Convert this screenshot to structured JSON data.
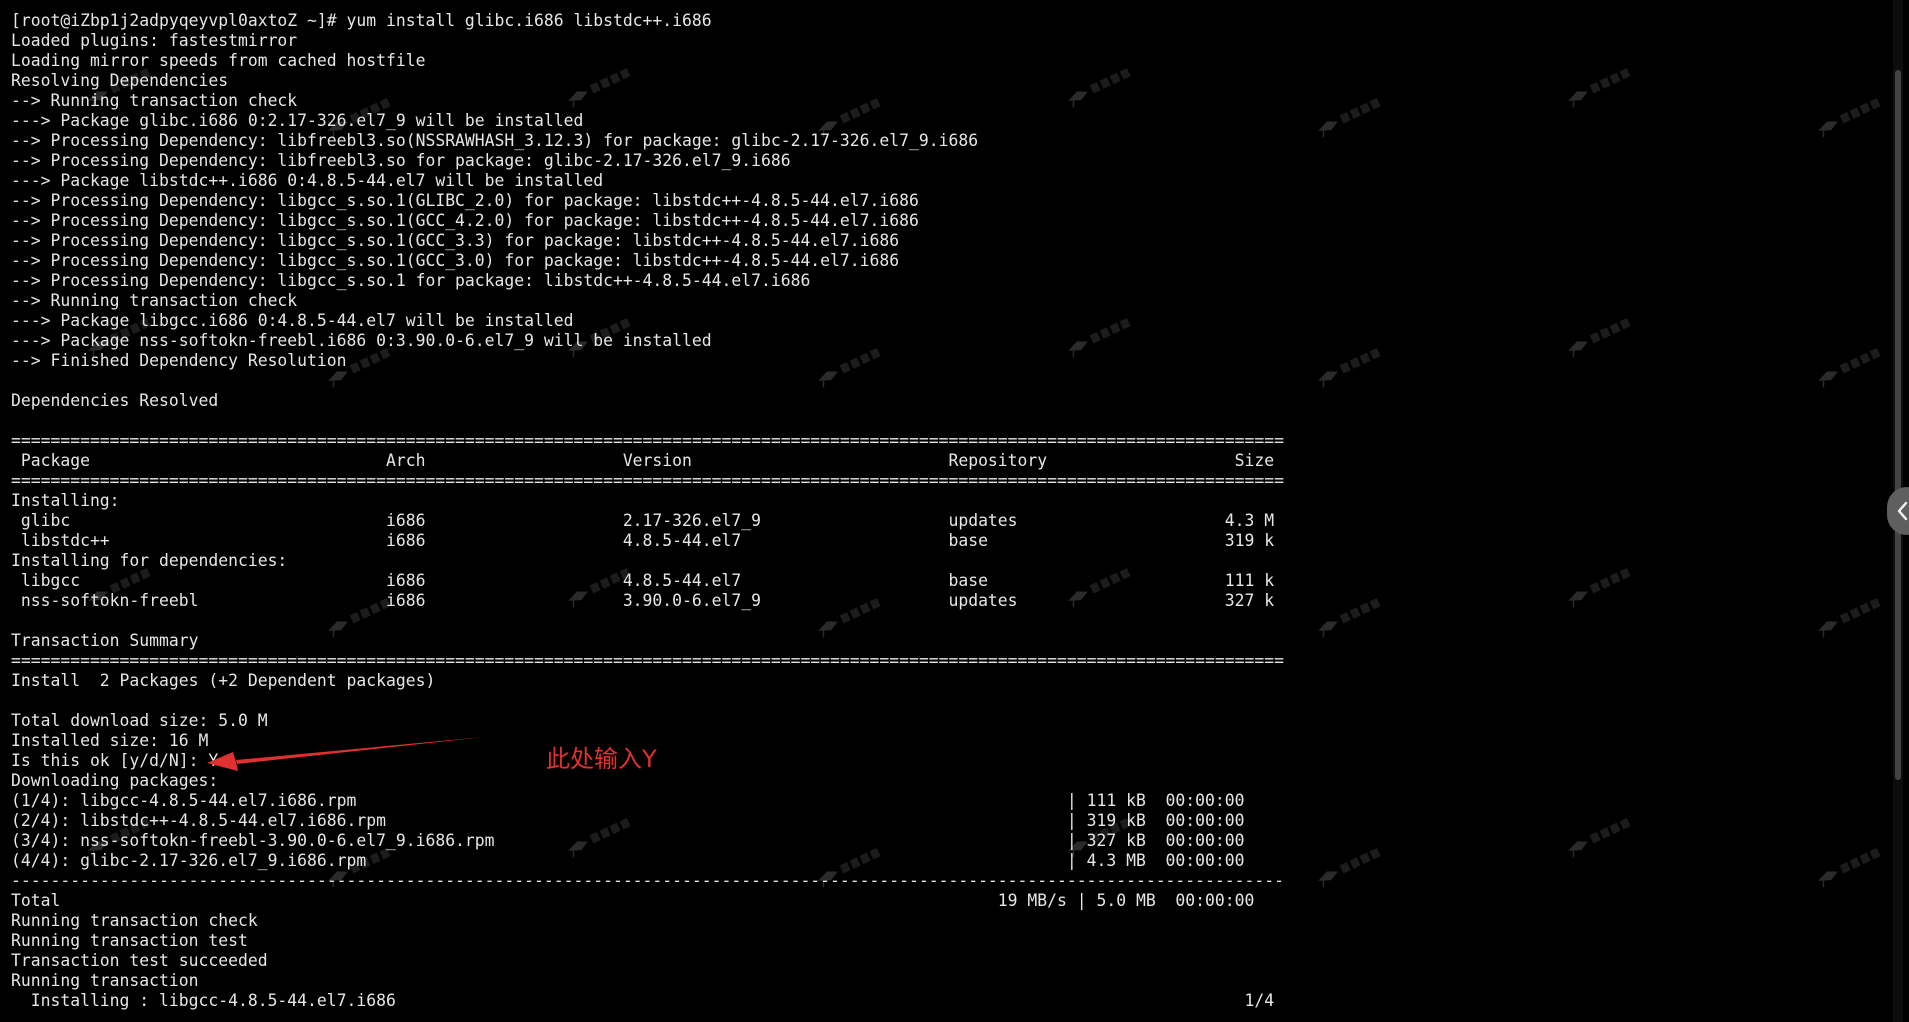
{
  "terminal": {
    "lines": [
      "[root@iZbp1j2adpyqeyvpl0axtoZ ~]# yum install glibc.i686 libstdc++.i686",
      "Loaded plugins: fastestmirror",
      "Loading mirror speeds from cached hostfile",
      "Resolving Dependencies",
      "--> Running transaction check",
      "---> Package glibc.i686 0:2.17-326.el7_9 will be installed",
      "--> Processing Dependency: libfreebl3.so(NSSRAWHASH_3.12.3) for package: glibc-2.17-326.el7_9.i686",
      "--> Processing Dependency: libfreebl3.so for package: glibc-2.17-326.el7_9.i686",
      "---> Package libstdc++.i686 0:4.8.5-44.el7 will be installed",
      "--> Processing Dependency: libgcc_s.so.1(GLIBC_2.0) for package: libstdc++-4.8.5-44.el7.i686",
      "--> Processing Dependency: libgcc_s.so.1(GCC_4.2.0) for package: libstdc++-4.8.5-44.el7.i686",
      "--> Processing Dependency: libgcc_s.so.1(GCC_3.3) for package: libstdc++-4.8.5-44.el7.i686",
      "--> Processing Dependency: libgcc_s.so.1(GCC_3.0) for package: libstdc++-4.8.5-44.el7.i686",
      "--> Processing Dependency: libgcc_s.so.1 for package: libstdc++-4.8.5-44.el7.i686",
      "--> Running transaction check",
      "---> Package libgcc.i686 0:4.8.5-44.el7 will be installed",
      "---> Package nss-softokn-freebl.i686 0:3.90.0-6.el7_9 will be installed",
      "--> Finished Dependency Resolution",
      "",
      "Dependencies Resolved",
      "",
      "=================================================================================================================================",
      " Package                              Arch                    Version                          Repository                   Size",
      "=================================================================================================================================",
      "Installing:",
      " glibc                                i686                    2.17-326.el7_9                   updates                     4.3 M",
      " libstdc++                            i686                    4.8.5-44.el7                     base                        319 k",
      "Installing for dependencies:",
      " libgcc                               i686                    4.8.5-44.el7                     base                        111 k",
      " nss-softokn-freebl                   i686                    3.90.0-6.el7_9                   updates                     327 k",
      "",
      "Transaction Summary",
      "=================================================================================================================================",
      "Install  2 Packages (+2 Dependent packages)",
      "",
      "Total download size: 5.0 M",
      "Installed size: 16 M",
      "Is this ok [y/d/N]: Y",
      "Downloading packages:",
      "(1/4): libgcc-4.8.5-44.el7.i686.rpm                                                                        | 111 kB  00:00:00",
      "(2/4): libstdc++-4.8.5-44.el7.i686.rpm                                                                     | 319 kB  00:00:00",
      "(3/4): nss-softokn-freebl-3.90.0-6.el7_9.i686.rpm                                                          | 327 kB  00:00:00",
      "(4/4): glibc-2.17-326.el7_9.i686.rpm                                                                       | 4.3 MB  00:00:00",
      "---------------------------------------------------------------------------------------------------------------------------------",
      "Total                                                                                               19 MB/s | 5.0 MB  00:00:00",
      "Running transaction check",
      "Running transaction test",
      "Transaction test succeeded",
      "Running transaction",
      "  Installing : libgcc-4.8.5-44.el7.i686                                                                                      1/4"
    ]
  },
  "annotation": {
    "text": "此处输入Y",
    "color": "#e03131"
  },
  "side_tab": {
    "icon": "chevron-left-icon"
  },
  "colors": {
    "background": "#000000",
    "foreground": "#e6e6e6"
  }
}
